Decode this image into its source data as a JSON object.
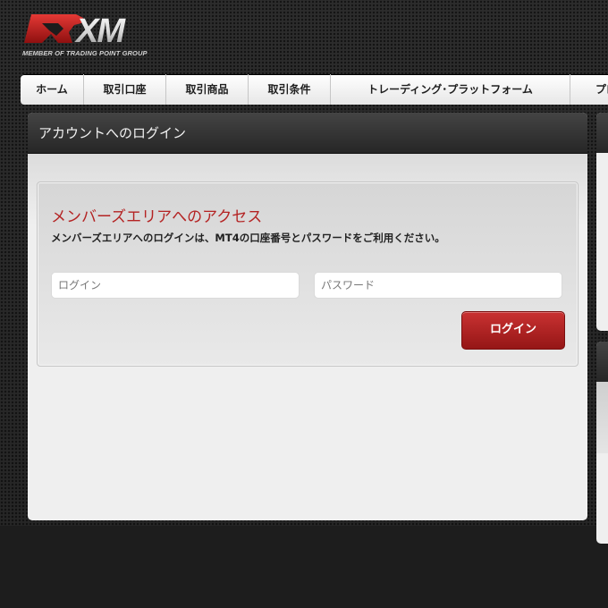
{
  "brand": {
    "logo_text": "XM",
    "tagline": "MEMBER OF TRADING POINT GROUP",
    "accent_color": "#c62828"
  },
  "nav": {
    "items": [
      {
        "label": "ホーム"
      },
      {
        "label": "取引口座"
      },
      {
        "label": "取引商品"
      },
      {
        "label": "取引条件"
      },
      {
        "label": "トレーディング･プラットフォーム"
      },
      {
        "label": "プロ"
      }
    ]
  },
  "panel": {
    "title": "アカウントへのログイン",
    "heading": "メンバーズエリアへのアクセス",
    "description": "メンバーズエリアへのログインは、MT4の口座番号とパスワードをご利用ください。",
    "login_placeholder": "ログイン",
    "password_placeholder": "パスワード",
    "submit_label": "ログイン"
  }
}
